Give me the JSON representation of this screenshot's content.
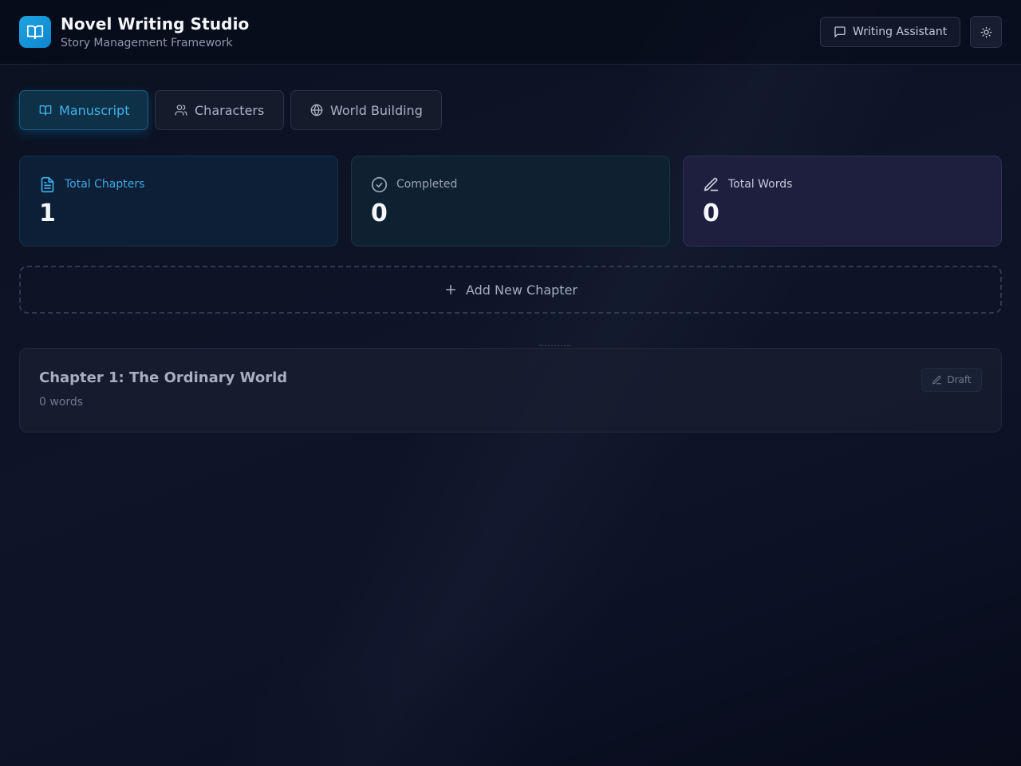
{
  "header": {
    "title": "Novel Writing Studio",
    "subtitle": "Story Management Framework",
    "logo_icon": "book-open-icon",
    "assistant_label": "Writing Assistant",
    "assistant_icon": "message-square-icon",
    "theme_icon": "sun-icon"
  },
  "tabs": [
    {
      "label": "Manuscript",
      "icon": "book-open-icon",
      "active": true
    },
    {
      "label": "Characters",
      "icon": "users-icon",
      "active": false
    },
    {
      "label": "World Building",
      "icon": "globe-icon",
      "active": false
    }
  ],
  "stats": [
    {
      "label": "Total Chapters",
      "value": "1",
      "icon": "file-text-icon"
    },
    {
      "label": "Completed",
      "value": "0",
      "icon": "check-circle-icon"
    },
    {
      "label": "Total Words",
      "value": "0",
      "icon": "pen-icon"
    }
  ],
  "add_chapter": {
    "label": "Add New Chapter",
    "icon": "plus-icon"
  },
  "chapters": [
    {
      "title": "Chapter 1: The Ordinary World",
      "words": "0 words",
      "status": "Draft",
      "status_icon": "pencil-icon"
    }
  ],
  "colors": {
    "accent": "#1fa3e0",
    "background": "#0d1327",
    "active_tab_text": "#3fb1ea"
  }
}
